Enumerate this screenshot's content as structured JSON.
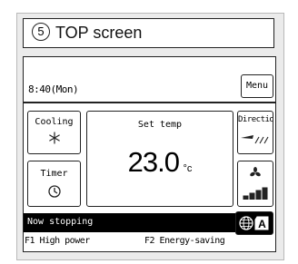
{
  "title": {
    "number": "5",
    "text": "TOP screen"
  },
  "clock": "8:40(Mon)",
  "menu_label": "Menu",
  "mode": {
    "label": "Cooling",
    "icon": "snowflake-icon"
  },
  "set_temp": {
    "label": "Set temp",
    "value": "23.0",
    "unit": "°c"
  },
  "direction": {
    "label": "Direction",
    "icon": "louver-direction-icon"
  },
  "timer": {
    "label": "Timer",
    "icon": "clock-icon"
  },
  "fan": {
    "icon": "fan-icon",
    "level": 4,
    "max_level": 4
  },
  "status_text": "Now stopping",
  "lang_button": {
    "icon": "globe-icon",
    "letter": "A"
  },
  "fkeys": {
    "f1": "F1 High power",
    "f2": "F2 Energy-saving"
  }
}
